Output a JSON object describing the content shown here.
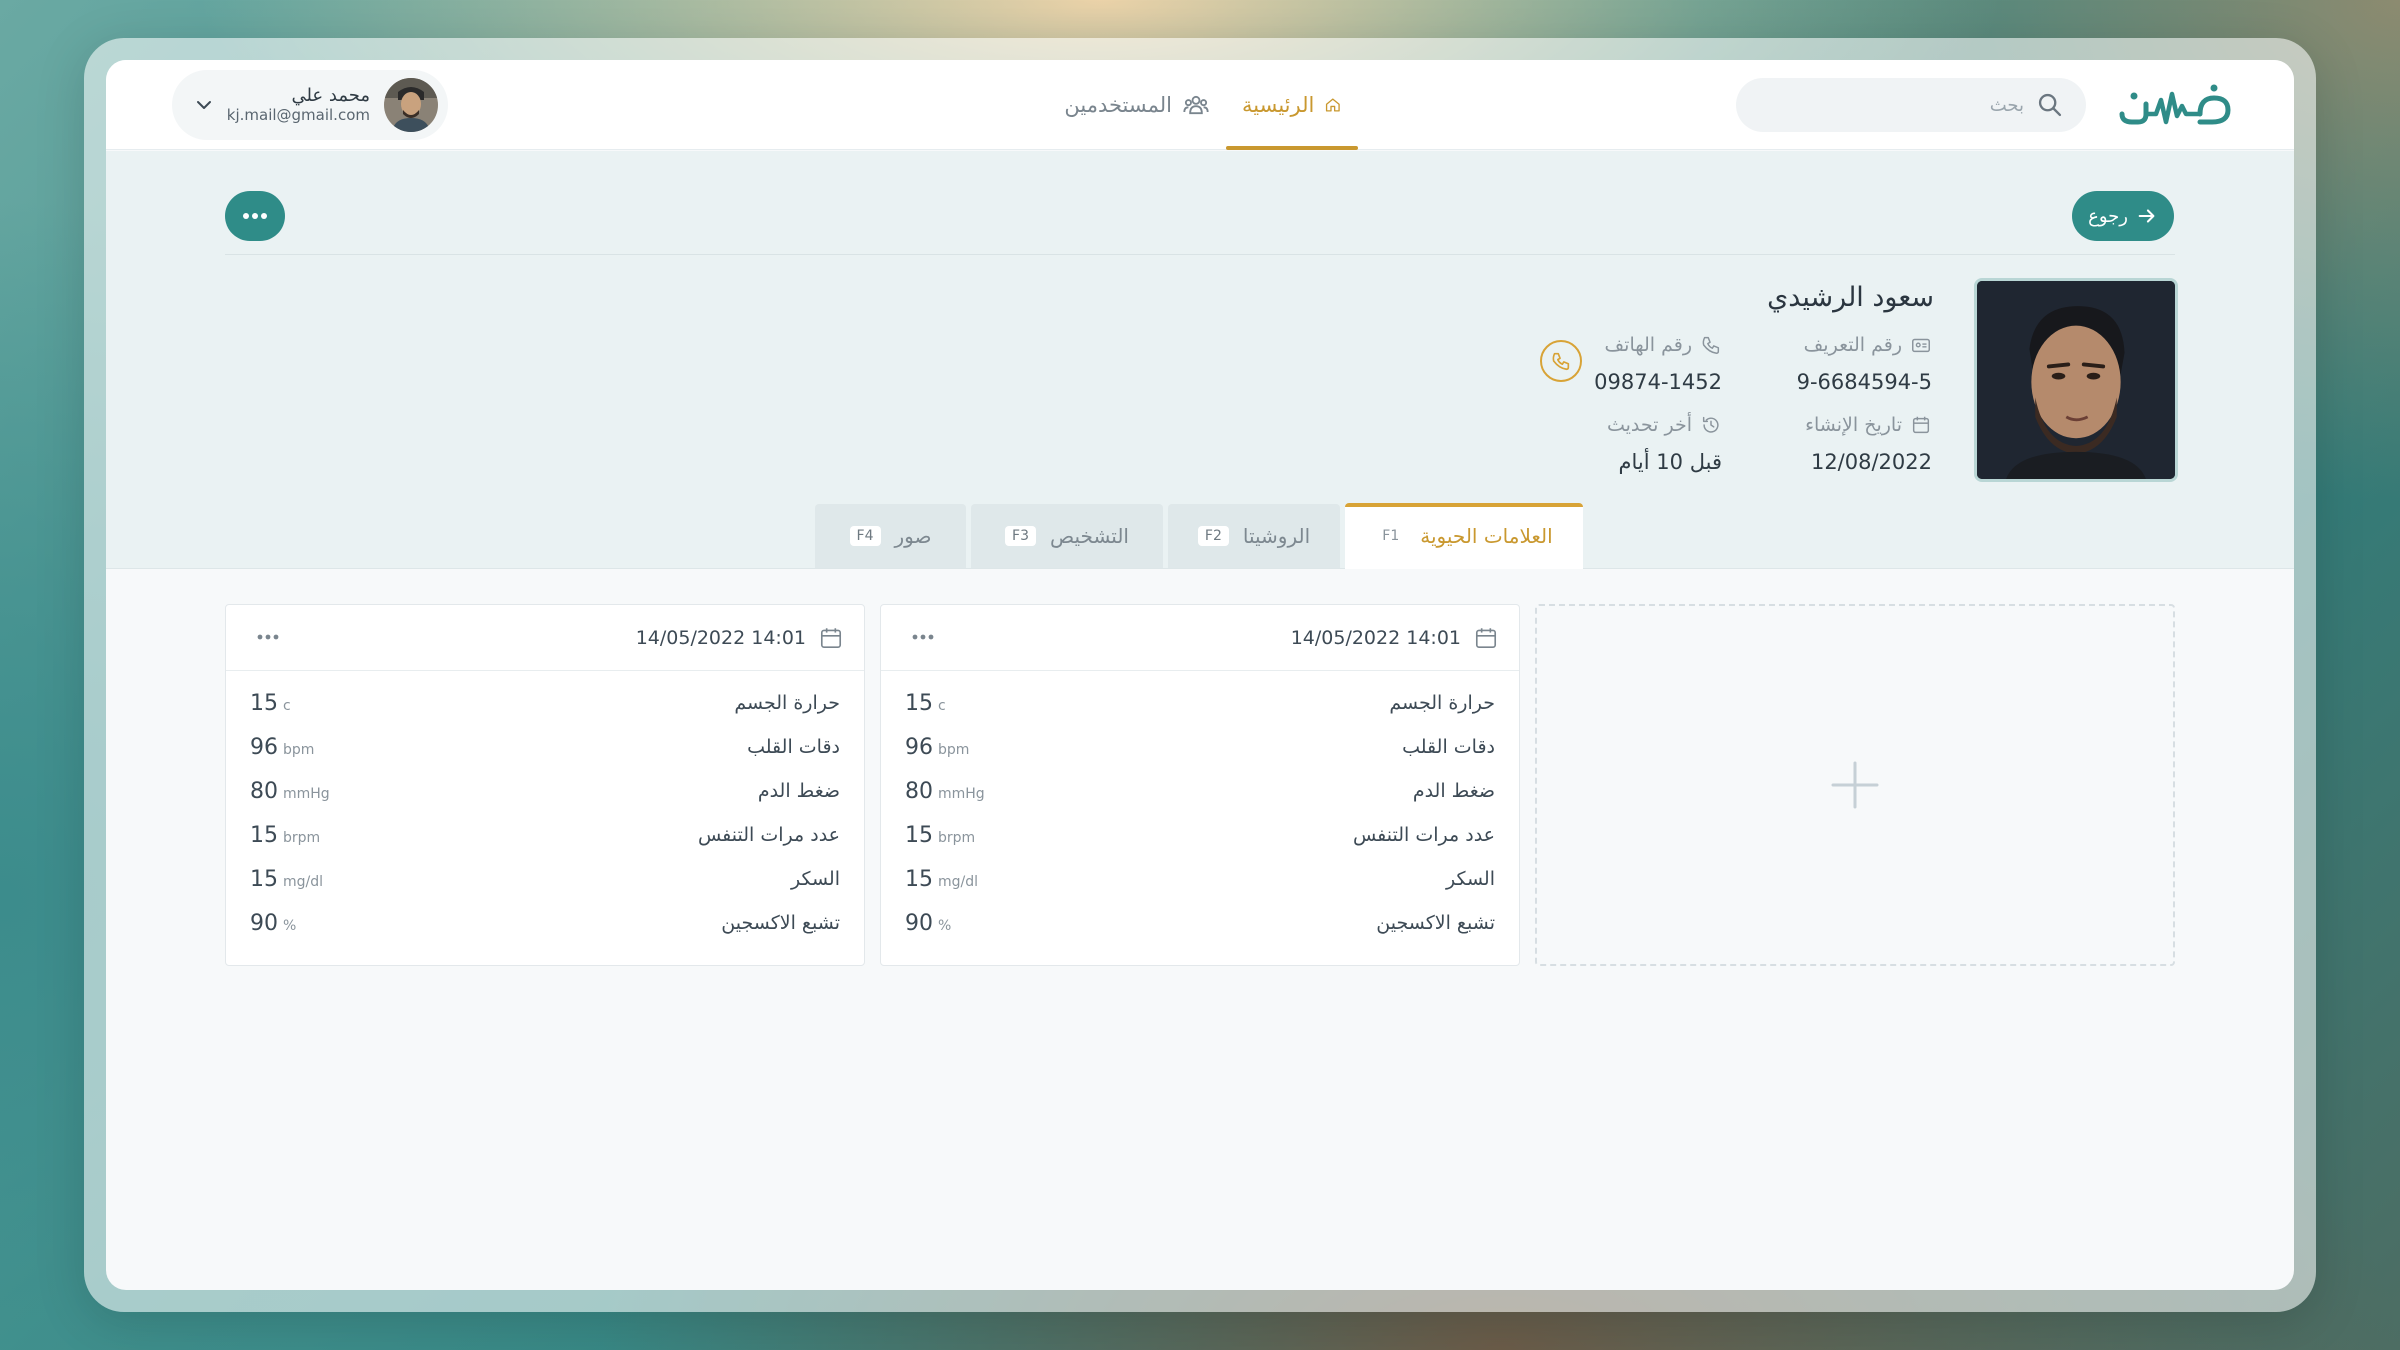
{
  "app": {
    "logo_text": "نبض"
  },
  "header": {
    "search_placeholder": "بحث",
    "nav": [
      {
        "label": "الرئيسية",
        "icon": "home-icon",
        "active": true
      },
      {
        "label": "المستخدمين",
        "icon": "users-icon",
        "active": false
      }
    ],
    "user": {
      "name": "محمد علي",
      "email": "kj.mail@gmail.com"
    }
  },
  "toolbar": {
    "back_label": "رجوع"
  },
  "patient": {
    "name": "سعود الرشيدي",
    "id_label": "رقم التعريف",
    "id_value": "9-6684594-5",
    "phone_label": "رقم الهاتف",
    "phone_value": "09874-1452",
    "created_label": "تاريخ الإنشاء",
    "created_value": "12/08/2022",
    "updated_label": "أخر تحديث",
    "updated_value": "قبل 10 أيام"
  },
  "tabs": [
    {
      "label": "العلامات الحيوية",
      "key": "F1",
      "active": true
    },
    {
      "label": "الروشيتا",
      "key": "F2",
      "active": false
    },
    {
      "label": "التشخيص",
      "key": "F3",
      "active": false
    },
    {
      "label": "صور",
      "key": "F4",
      "active": false
    }
  ],
  "vitals_cards": [
    {
      "datetime": "14/05/2022 14:01",
      "rows": [
        {
          "label": "حرارة الجسم",
          "value": "15",
          "unit": "c"
        },
        {
          "label": "دقات القلب",
          "value": "96",
          "unit": "bpm"
        },
        {
          "label": "ضغط الدم",
          "value": "80",
          "unit": "mmHg"
        },
        {
          "label": "عدد مرات التنفس",
          "value": "15",
          "unit": "brpm"
        },
        {
          "label": "السكر",
          "value": "15",
          "unit": "mg/dl"
        },
        {
          "label": "تشبع الاكسجين",
          "value": "90",
          "unit": "%"
        }
      ]
    },
    {
      "datetime": "14/05/2022 14:01",
      "rows": [
        {
          "label": "حرارة الجسم",
          "value": "15",
          "unit": "c"
        },
        {
          "label": "دقات القلب",
          "value": "96",
          "unit": "bpm"
        },
        {
          "label": "ضغط الدم",
          "value": "80",
          "unit": "mmHg"
        },
        {
          "label": "عدد مرات التنفس",
          "value": "15",
          "unit": "brpm"
        },
        {
          "label": "السكر",
          "value": "15",
          "unit": "mg/dl"
        },
        {
          "label": "تشبع الاكسجين",
          "value": "90",
          "unit": "%"
        }
      ]
    }
  ],
  "colors": {
    "primary": "#2f8c88",
    "accent": "#c9982f",
    "background": "#f7f9fa"
  }
}
